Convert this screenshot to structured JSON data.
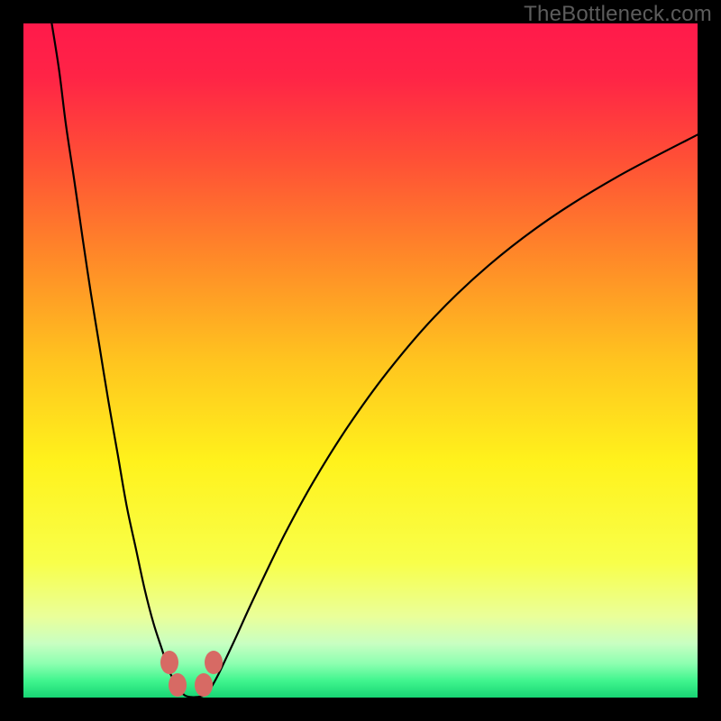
{
  "watermark": "TheBottleneck.com",
  "chart_data": {
    "type": "line",
    "title": "",
    "xlabel": "",
    "ylabel": "",
    "xlim": [
      0,
      100
    ],
    "ylim": [
      0,
      100
    ],
    "gradient_stops": [
      {
        "offset": 0.0,
        "color": "#ff1a4b"
      },
      {
        "offset": 0.08,
        "color": "#ff2446"
      },
      {
        "offset": 0.2,
        "color": "#ff4f36"
      },
      {
        "offset": 0.35,
        "color": "#ff8a28"
      },
      {
        "offset": 0.5,
        "color": "#ffc41f"
      },
      {
        "offset": 0.65,
        "color": "#fff21c"
      },
      {
        "offset": 0.8,
        "color": "#f8ff4a"
      },
      {
        "offset": 0.88,
        "color": "#eaff9a"
      },
      {
        "offset": 0.92,
        "color": "#c8ffc2"
      },
      {
        "offset": 0.95,
        "color": "#8cffb0"
      },
      {
        "offset": 0.975,
        "color": "#40f58e"
      },
      {
        "offset": 1.0,
        "color": "#18d574"
      }
    ],
    "series": [
      {
        "name": "left-branch",
        "color": "#000000",
        "x": [
          4.2,
          5.3,
          6.3,
          7.5,
          8.8,
          10.0,
          11.3,
          12.6,
          14.0,
          15.3,
          16.7,
          18.0,
          19.3,
          20.6,
          21.5,
          22.3,
          23.0,
          23.6,
          24.2,
          25.2
        ],
        "y": [
          100,
          93,
          85,
          77,
          68,
          60,
          52,
          44,
          36,
          28.5,
          22,
          16,
          11,
          7,
          4.2,
          2.6,
          1.4,
          0.6,
          0.2,
          0.05
        ]
      },
      {
        "name": "right-branch",
        "color": "#000000",
        "x": [
          25.2,
          26.5,
          27.2,
          27.9,
          28.8,
          30.0,
          31.5,
          33.5,
          36.0,
          39.0,
          43.0,
          48.0,
          54.0,
          61.0,
          69.0,
          78.0,
          88.0,
          100.0
        ],
        "y": [
          0.05,
          0.2,
          0.7,
          1.6,
          3.2,
          5.7,
          8.9,
          13.3,
          18.6,
          24.7,
          32.0,
          40.0,
          48.3,
          56.5,
          64.1,
          71.0,
          77.2,
          83.5
        ]
      }
    ],
    "markers": [
      {
        "x": 21.6,
        "y": 5.2,
        "color": "#d76a64"
      },
      {
        "x": 22.9,
        "y": 1.9,
        "color": "#d76a64"
      },
      {
        "x": 26.8,
        "y": 1.9,
        "color": "#d76a64"
      },
      {
        "x": 28.2,
        "y": 5.2,
        "color": "#d76a64"
      }
    ],
    "valley_x": 25.2
  }
}
